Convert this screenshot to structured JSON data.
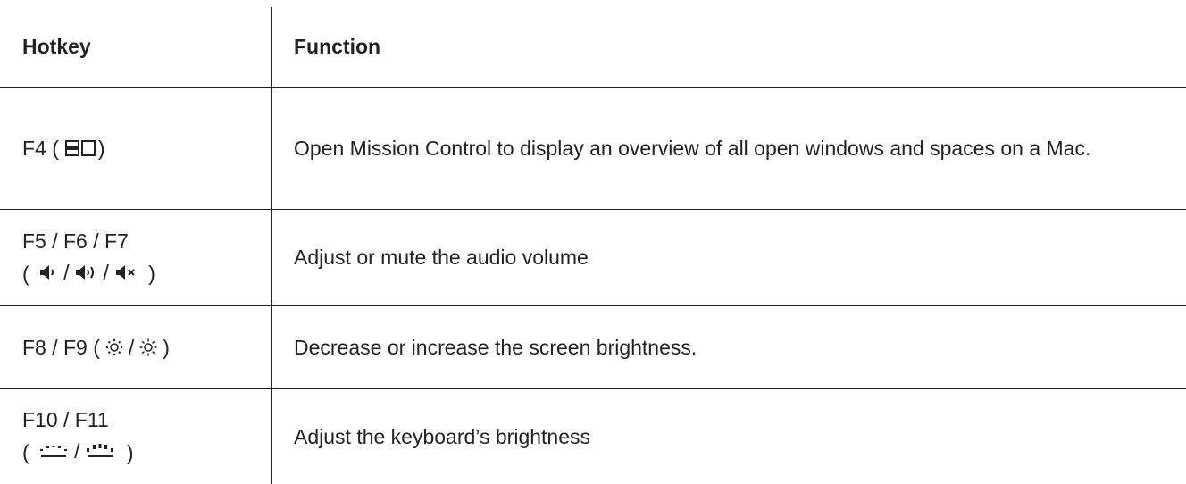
{
  "header": {
    "hotkey": "Hotkey",
    "function": "Function"
  },
  "rows": [
    {
      "key_line1": "F4 (",
      "key_line1_close": ")",
      "icons": [
        "mission-control-icon"
      ],
      "function": "Open Mission Control to display an overview of all open windows and spaces on a Mac."
    },
    {
      "key_line1": "F5 / F6 / F7",
      "key_line2_open": "(",
      "sep": "/",
      "key_line2_close": ")",
      "icons": [
        "volume-down-icon",
        "volume-up-icon",
        "volume-mute-icon"
      ],
      "function": "Adjust or mute the audio volume"
    },
    {
      "key_line1": "F8 / F9 (",
      "sep": "/",
      "key_line1_close": ")",
      "icons": [
        "brightness-down-icon",
        "brightness-up-icon"
      ],
      "function": "Decrease or increase the screen brightness."
    },
    {
      "key_line1": "F10 / F11",
      "key_line2_open": "(",
      "sep": "/",
      "key_line2_close": ")",
      "icons": [
        "keyboard-backlight-down-icon",
        "keyboard-backlight-up-icon"
      ],
      "function": "Adjust the keyboard’s brightness"
    }
  ]
}
